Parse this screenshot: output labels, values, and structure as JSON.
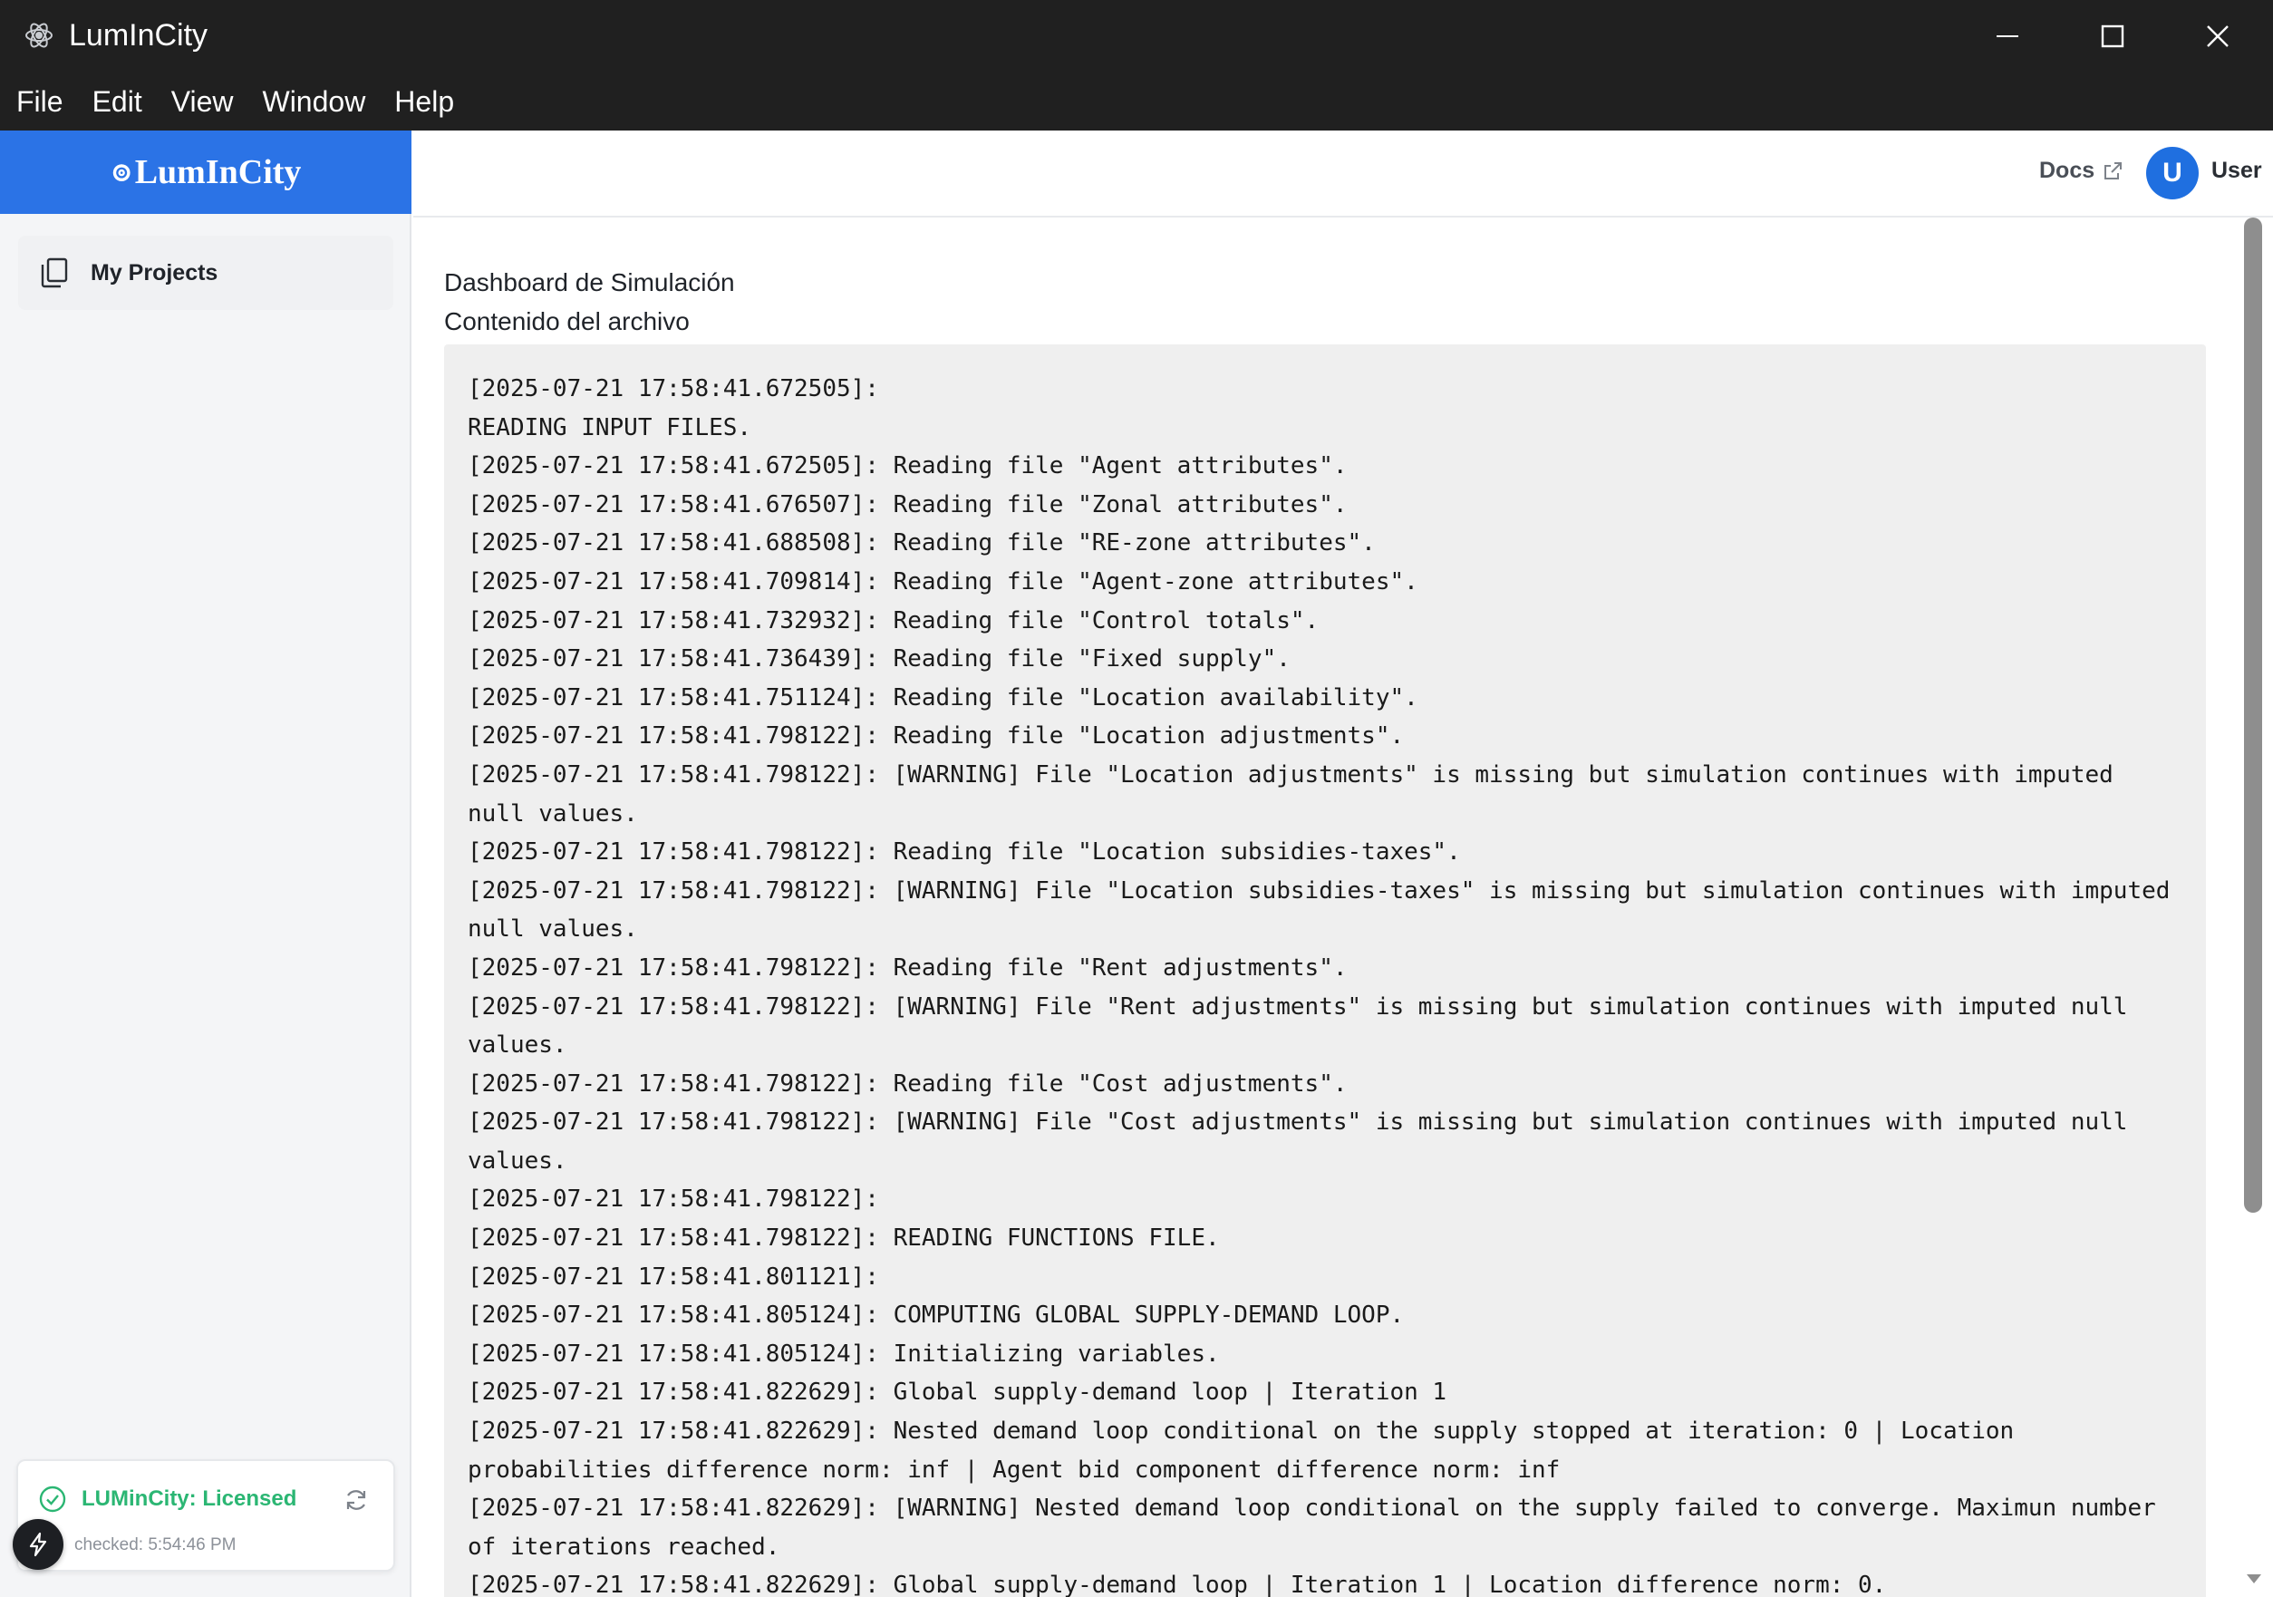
{
  "window": {
    "title": "LumInCity",
    "controls": {
      "minimize": "minimize-icon",
      "maximize": "maximize-icon",
      "close": "close-icon"
    }
  },
  "menu": [
    {
      "label": "File"
    },
    {
      "label": "Edit"
    },
    {
      "label": "View"
    },
    {
      "label": "Window"
    },
    {
      "label": "Help"
    }
  ],
  "sidebar": {
    "brand": "LumInCity",
    "items": [
      {
        "label": "My Projects",
        "icon": "documents-icon"
      }
    ],
    "license": {
      "status": "LUMinCity: Licensed",
      "checked": "checked: 5:54:46 PM"
    }
  },
  "header": {
    "docs_label": "Docs",
    "avatar_initial": "U",
    "user_name": "User"
  },
  "main": {
    "title": "Dashboard de Simulación",
    "file_label": "Contenido del archivo",
    "log_lines": [
      "[2025-07-21 17:58:41.672505]:",
      "READING INPUT FILES.",
      "[2025-07-21 17:58:41.672505]: Reading file \"Agent attributes\".",
      "[2025-07-21 17:58:41.676507]: Reading file \"Zonal attributes\".",
      "[2025-07-21 17:58:41.688508]: Reading file \"RE-zone attributes\".",
      "[2025-07-21 17:58:41.709814]: Reading file \"Agent-zone attributes\".",
      "[2025-07-21 17:58:41.732932]: Reading file \"Control totals\".",
      "[2025-07-21 17:58:41.736439]: Reading file \"Fixed supply\".",
      "[2025-07-21 17:58:41.751124]: Reading file \"Location availability\".",
      "[2025-07-21 17:58:41.798122]: Reading file \"Location adjustments\".",
      "[2025-07-21 17:58:41.798122]: [WARNING] File \"Location adjustments\" is missing but simulation continues with imputed null values.",
      "[2025-07-21 17:58:41.798122]: Reading file \"Location subsidies-taxes\".",
      "[2025-07-21 17:58:41.798122]: [WARNING] File \"Location subsidies-taxes\" is missing but simulation continues with imputed null values.",
      "[2025-07-21 17:58:41.798122]: Reading file \"Rent adjustments\".",
      "[2025-07-21 17:58:41.798122]: [WARNING] File \"Rent adjustments\" is missing but simulation continues with imputed null values.",
      "[2025-07-21 17:58:41.798122]: Reading file \"Cost adjustments\".",
      "[2025-07-21 17:58:41.798122]: [WARNING] File \"Cost adjustments\" is missing but simulation continues with imputed null values.",
      "[2025-07-21 17:58:41.798122]:",
      "[2025-07-21 17:58:41.798122]: READING FUNCTIONS FILE.",
      "[2025-07-21 17:58:41.801121]:",
      "[2025-07-21 17:58:41.805124]: COMPUTING GLOBAL SUPPLY-DEMAND LOOP.",
      "[2025-07-21 17:58:41.805124]: Initializing variables.",
      "[2025-07-21 17:58:41.822629]: Global supply-demand loop | Iteration 1",
      "[2025-07-21 17:58:41.822629]: Nested demand loop conditional on the supply stopped at iteration: 0 | Location probabilities difference norm: inf | Agent bid component difference norm: inf",
      "[2025-07-21 17:58:41.822629]: [WARNING] Nested demand loop conditional on the supply failed to converge. Maximun number of iterations reached.",
      "[2025-07-21 17:58:41.822629]: Global supply-demand loop | Iteration 1 | Location difference norm: 0."
    ]
  }
}
